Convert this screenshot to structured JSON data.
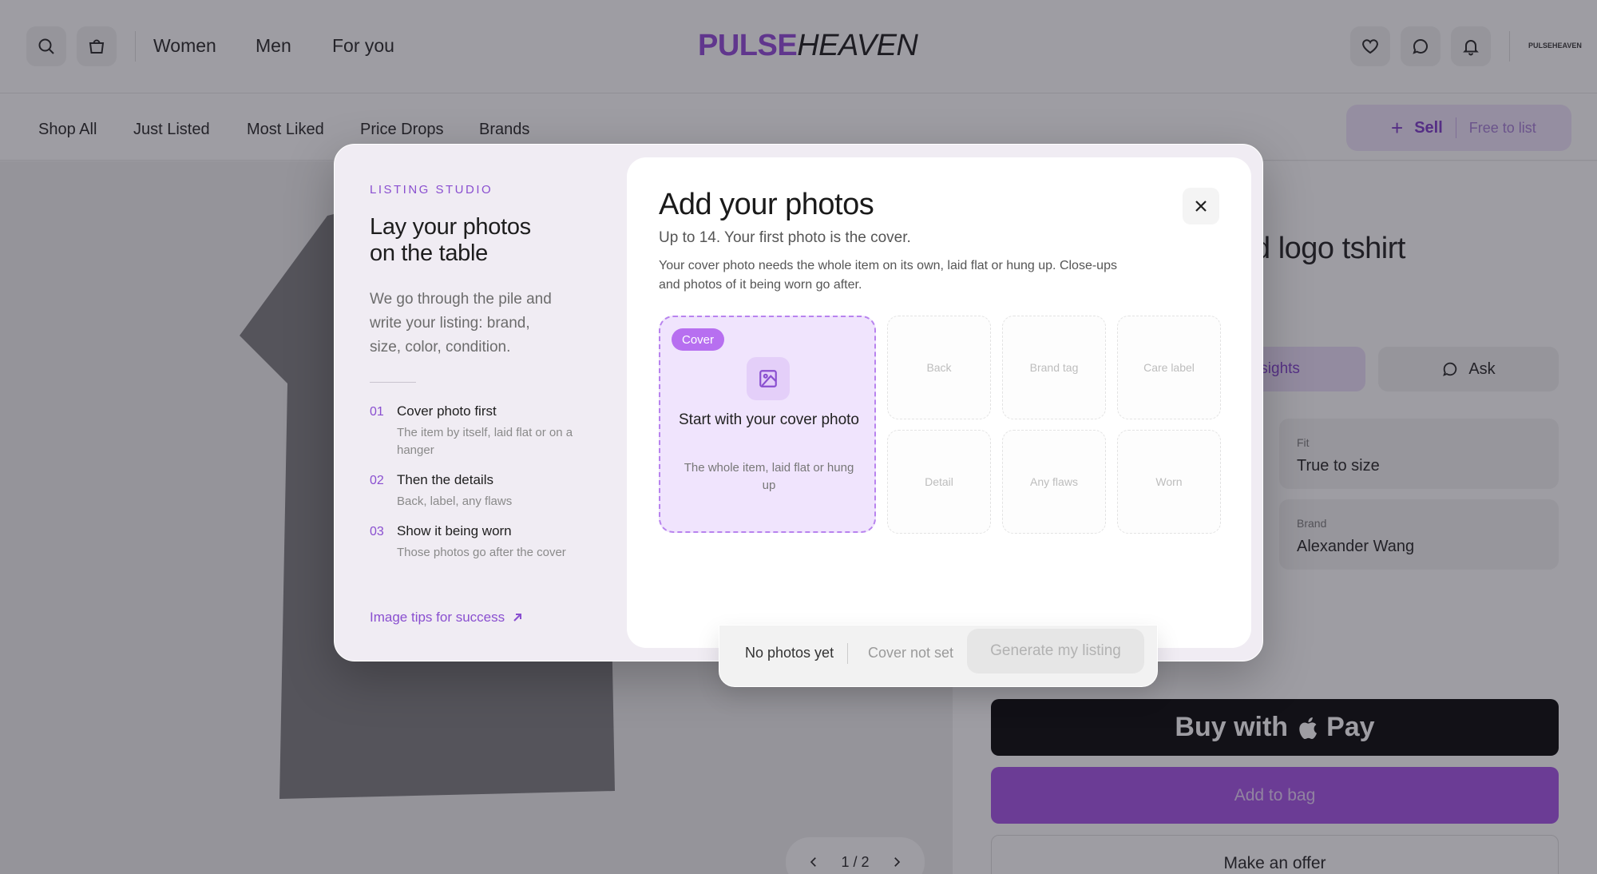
{
  "header": {
    "nav": [
      "Women",
      "Men",
      "For you"
    ],
    "logo_part1": "PULSE",
    "logo_part2": "HEAVEN",
    "small_logo": "PULSEHEAVEN"
  },
  "subnav": {
    "items": [
      "Shop All",
      "Just Listed",
      "Most Liked",
      "Price Drops",
      "Brands"
    ],
    "sell_label": "Sell",
    "sell_plus": "+",
    "free_label": "Free to list"
  },
  "product": {
    "title_visible": "d logo tshirt",
    "insights_label": "l insights",
    "ask_label": "Ask",
    "attributes": [
      {
        "key": "Fit",
        "value": "True to size"
      },
      {
        "key": "Brand",
        "value": "Alexander Wang"
      }
    ],
    "buy_with": "Buy with",
    "pay": "Pay",
    "add_to_bag": "Add to bag",
    "make_offer": "Make an offer",
    "pager": "1 / 2"
  },
  "studio": {
    "eyebrow": "LISTING STUDIO",
    "title": "Lay your photos on the table",
    "description": "We go through the pile and write your listing: brand, size, color, condition.",
    "steps": [
      {
        "num": "01",
        "title": "Cover photo first",
        "sub": "The item by itself, laid flat or on a hanger"
      },
      {
        "num": "02",
        "title": "Then the details",
        "sub": "Back, label, any flaws"
      },
      {
        "num": "03",
        "title": "Show it being worn",
        "sub": "Those photos go after the cover"
      }
    ],
    "tips_link": "Image tips for success"
  },
  "upload": {
    "title": "Add your photos",
    "subtitle": "Up to 14. Your first photo is the cover.",
    "body": "Your cover photo needs the whole item on its own, laid flat or hung up. Close-ups and photos of it being worn go after.",
    "cover_badge": "Cover",
    "cover_main": "Start with your cover photo",
    "cover_sub": "The whole item, laid flat or hung up",
    "slots": [
      "Back",
      "Brand tag",
      "Care label",
      "Detail",
      "Any flaws",
      "Worn"
    ]
  },
  "footer": {
    "photos_status": "No photos yet",
    "cover_status": "Cover not set",
    "generate_label": "Generate my listing"
  },
  "colors": {
    "accent": "#8e44d8",
    "accent_light": "#f0e4fd",
    "buy_bg": "#000000",
    "add_bag_bg": "#a24fe6"
  }
}
